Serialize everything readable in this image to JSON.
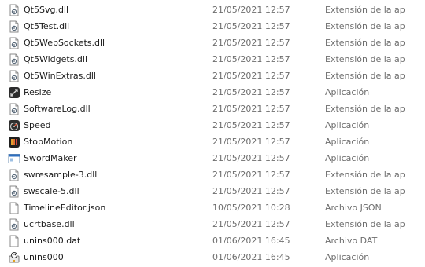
{
  "files": [
    {
      "name": "Qt5Svg.dll",
      "date": "21/05/2021 12:57",
      "type": "Extensión de la ap",
      "icon": "dll-file-icon"
    },
    {
      "name": "Qt5Test.dll",
      "date": "21/05/2021 12:57",
      "type": "Extensión de la ap",
      "icon": "dll-file-icon"
    },
    {
      "name": "Qt5WebSockets.dll",
      "date": "21/05/2021 12:57",
      "type": "Extensión de la ap",
      "icon": "dll-file-icon"
    },
    {
      "name": "Qt5Widgets.dll",
      "date": "21/05/2021 12:57",
      "type": "Extensión de la ap",
      "icon": "dll-file-icon"
    },
    {
      "name": "Qt5WinExtras.dll",
      "date": "21/05/2021 12:57",
      "type": "Extensión de la ap",
      "icon": "dll-file-icon"
    },
    {
      "name": "Resize",
      "date": "21/05/2021 12:57",
      "type": "Aplicación",
      "icon": "resize-app-icon"
    },
    {
      "name": "SoftwareLog.dll",
      "date": "21/05/2021 12:57",
      "type": "Extensión de la ap",
      "icon": "dll-file-icon"
    },
    {
      "name": "Speed",
      "date": "21/05/2021 12:57",
      "type": "Aplicación",
      "icon": "speed-app-icon"
    },
    {
      "name": "StopMotion",
      "date": "21/05/2021 12:57",
      "type": "Aplicación",
      "icon": "stopmotion-app-icon"
    },
    {
      "name": "SwordMaker",
      "date": "21/05/2021 12:57",
      "type": "Aplicación",
      "icon": "window-app-icon"
    },
    {
      "name": "swresample-3.dll",
      "date": "21/05/2021 12:57",
      "type": "Extensión de la ap",
      "icon": "dll-file-icon"
    },
    {
      "name": "swscale-5.dll",
      "date": "21/05/2021 12:57",
      "type": "Extensión de la ap",
      "icon": "dll-file-icon"
    },
    {
      "name": "TimelineEditor.json",
      "date": "10/05/2021 10:28",
      "type": "Archivo JSON",
      "icon": "blank-file-icon"
    },
    {
      "name": "ucrtbase.dll",
      "date": "21/05/2021 12:57",
      "type": "Extensión de la ap",
      "icon": "dll-file-icon"
    },
    {
      "name": "unins000.dat",
      "date": "01/06/2021 16:45",
      "type": "Archivo DAT",
      "icon": "blank-file-icon"
    },
    {
      "name": "unins000",
      "date": "01/06/2021 16:45",
      "type": "Aplicación",
      "icon": "installer-app-icon"
    }
  ]
}
